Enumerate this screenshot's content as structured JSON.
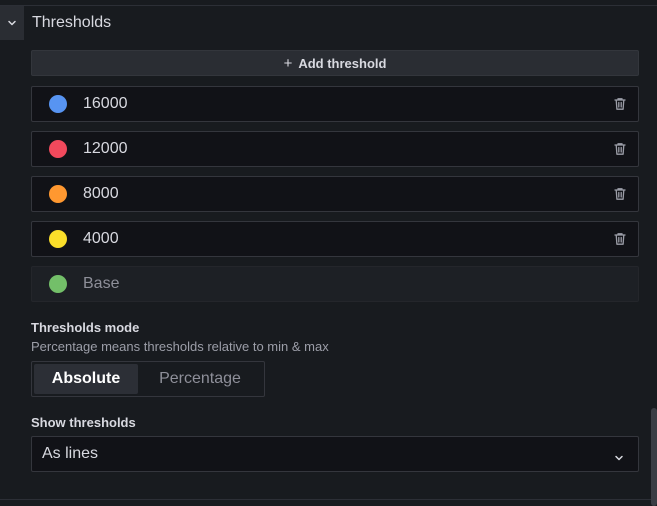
{
  "section": {
    "title": "Thresholds",
    "collapse_icon": "chevron-down-icon"
  },
  "add_threshold": {
    "icon": "plus-icon",
    "label": "Add threshold"
  },
  "thresholds": [
    {
      "value": "16000",
      "color": "#5794f2",
      "deletable": true
    },
    {
      "value": "12000",
      "color": "#f2495c",
      "deletable": true
    },
    {
      "value": "8000",
      "color": "#ff9830",
      "deletable": true
    },
    {
      "value": "4000",
      "color": "#fade2a",
      "deletable": true
    },
    {
      "value": "Base",
      "color": "#73bf69",
      "deletable": false
    }
  ],
  "thresholds_mode": {
    "label": "Thresholds mode",
    "description": "Percentage means thresholds relative to min & max",
    "options": [
      "Absolute",
      "Percentage"
    ],
    "selected": "Absolute"
  },
  "show_thresholds": {
    "label": "Show thresholds",
    "value": "As lines",
    "caret_icon": "chevron-down-icon"
  }
}
